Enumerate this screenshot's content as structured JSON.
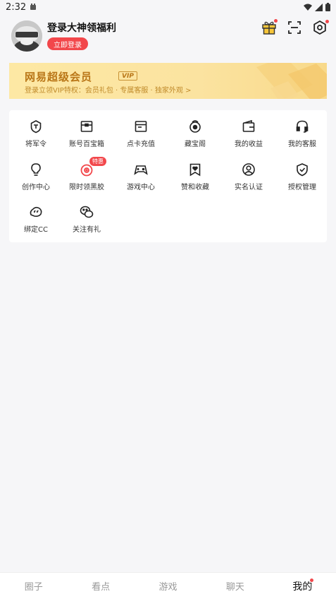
{
  "status_bar": {
    "time": "2:32"
  },
  "header": {
    "login_title": "登录大神领福利",
    "login_button": "立即登录"
  },
  "vip_banner": {
    "title": "网易超级会员",
    "badge": "VIP",
    "subtitle": "登录立领VIP特权：会员礼包 · 专属客服 · 独家外观  >"
  },
  "services": [
    {
      "label": "将军令",
      "icon": "token-shield-icon"
    },
    {
      "label": "账号百宝箱",
      "icon": "treasure-box-icon"
    },
    {
      "label": "点卡充值",
      "icon": "card-recharge-icon"
    },
    {
      "label": "藏宝阁",
      "icon": "treasure-pavilion-icon"
    },
    {
      "label": "我的收益",
      "icon": "wallet-icon"
    },
    {
      "label": "我的客服",
      "icon": "headset-icon"
    },
    {
      "label": "创作中心",
      "icon": "lightbulb-icon"
    },
    {
      "label": "限时领黑胶",
      "icon": "vinyl-record-icon",
      "badge": "特惠"
    },
    {
      "label": "游戏中心",
      "icon": "gamepad-icon"
    },
    {
      "label": "赞和收藏",
      "icon": "bookmark-heart-icon"
    },
    {
      "label": "实名认证",
      "icon": "person-circle-icon"
    },
    {
      "label": "授权管理",
      "icon": "shield-check-icon"
    },
    {
      "label": "绑定CC",
      "icon": "cc-link-icon"
    },
    {
      "label": "关注有礼",
      "icon": "wechat-icon"
    }
  ],
  "bottom_nav": [
    {
      "label": "圈子"
    },
    {
      "label": "看点"
    },
    {
      "label": "游戏"
    },
    {
      "label": "聊天"
    },
    {
      "label": "我的"
    }
  ],
  "colors": {
    "accent": "#f2474b",
    "vip_gold": "#b97617",
    "background": "#f6f6f8"
  }
}
